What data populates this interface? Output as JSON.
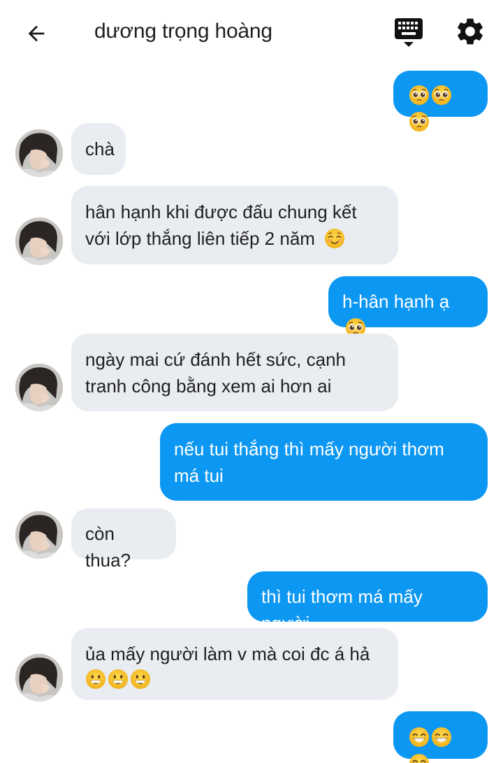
{
  "header": {
    "back_icon": "arrow-left-icon",
    "title": "dương trọng hoàng",
    "keyboard_icon": "keyboard-icon",
    "settings_icon": "gear-icon"
  },
  "messages": [
    {
      "side": "out",
      "text": "",
      "emoji": [
        "pleading-face",
        "pleading-face",
        "pleading-face"
      ]
    },
    {
      "side": "in",
      "text": "chà",
      "emoji": []
    },
    {
      "side": "in",
      "text": "hân hạnh khi được đấu chung kết với lớp thắng liên tiếp 2 năm",
      "emoji": [
        "smiling-face"
      ]
    },
    {
      "side": "out",
      "text": "h-hân hạnh ạ",
      "emoji": [
        "pleading-face"
      ]
    },
    {
      "side": "in",
      "text": "ngày mai cứ đánh hết sức, cạnh tranh công bằng xem ai hơn ai",
      "emoji": []
    },
    {
      "side": "out",
      "text": "nếu tui thắng thì mấy người thơm má tui",
      "emoji": []
    },
    {
      "side": "in",
      "text": "còn thua?",
      "emoji": []
    },
    {
      "side": "out",
      "text": "thì tui thơm má mấy người",
      "emoji": []
    },
    {
      "side": "in",
      "text": "ủa mấy người làm v mà coi đc á hả",
      "emoji": [
        "grinning-face",
        "grinning-face",
        "grinning-face"
      ]
    },
    {
      "side": "out",
      "text": "",
      "emoji": [
        "beaming-face",
        "beaming-face",
        "beaming-face"
      ]
    }
  ],
  "colors": {
    "outgoing_bubble": "#0c97f2",
    "incoming_bubble": "#e9ecf0",
    "emoji_yellow": "#f7c531"
  }
}
